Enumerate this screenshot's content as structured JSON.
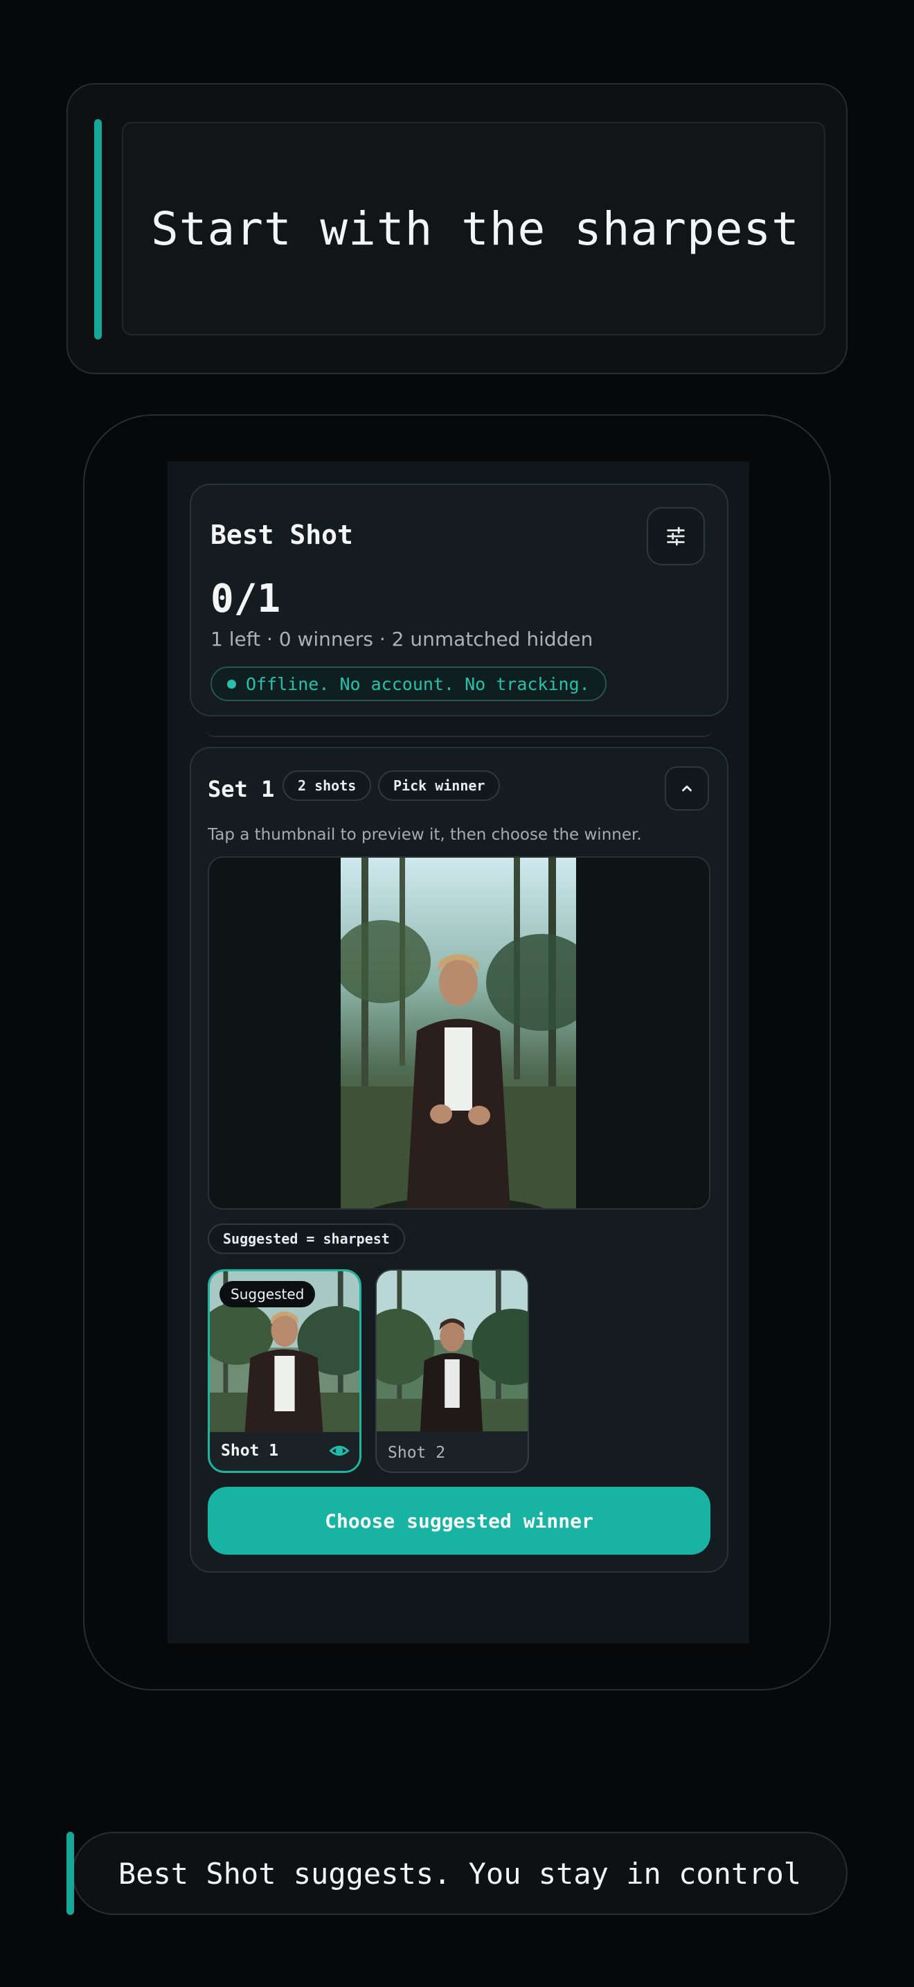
{
  "hero": {
    "headline": "Start with the sharpest"
  },
  "app": {
    "title": "Best Shot",
    "progress": "0/1",
    "stats": "1 left · 0 winners · 2 unmatched hidden",
    "privacy_badge": "Offline. No account. No tracking."
  },
  "set": {
    "title": "Set 1",
    "shots_pill": "2 shots",
    "status_pill": "Pick winner",
    "hint": "Tap a thumbnail to preview it, then choose the winner.",
    "suggestion_rule": "Suggested = sharpest",
    "thumbnails": [
      {
        "label": "Shot 1",
        "badge": "Suggested",
        "selected": true
      },
      {
        "label": "Shot 2",
        "badge": "",
        "selected": false
      }
    ],
    "primary_action": "Choose suggested winner"
  },
  "footer": {
    "tagline": "Best Shot suggests. You stay in control"
  },
  "colors": {
    "accent": "#19b3a3",
    "background": "#07080a",
    "card": "#151c20"
  },
  "icons": [
    "sliders-icon",
    "chevron-up-icon",
    "eye-icon"
  ]
}
